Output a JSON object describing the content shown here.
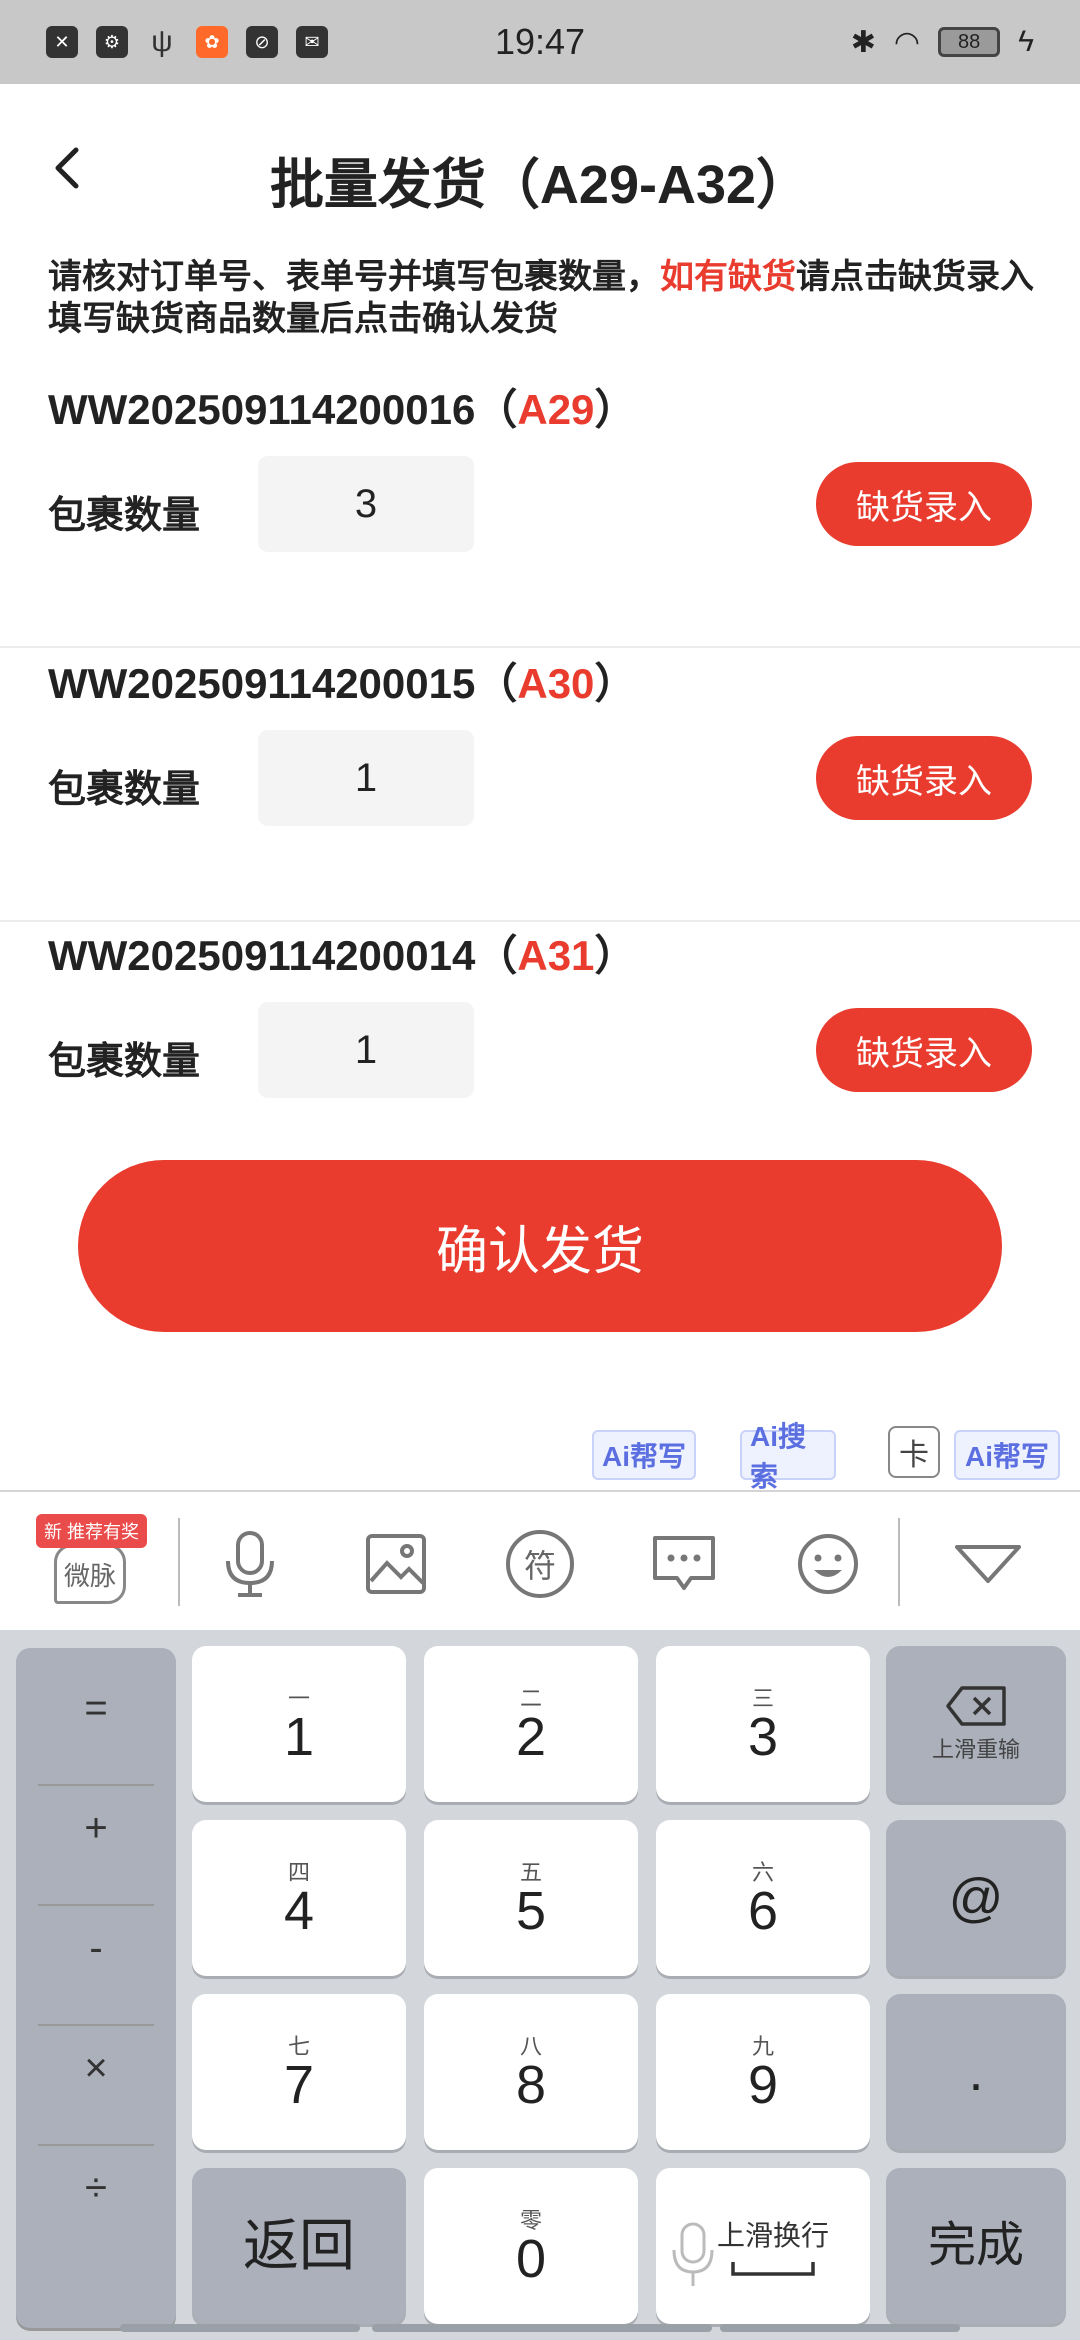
{
  "status_bar": {
    "time": "19:47",
    "battery": "88"
  },
  "header": {
    "title": "批量发货（A29-A32）"
  },
  "notice": {
    "part1": "请核对订单号、表单号并填写包裹数量，",
    "highlight": "如有缺货",
    "part2": "请点击缺货录入填写缺货商品数量后点击确认发货"
  },
  "orders": [
    {
      "id": "WW202509114200016",
      "code": "A29",
      "qty_label": "包裹数量",
      "qty": "3",
      "button": "缺货录入"
    },
    {
      "id": "WW202509114200015",
      "code": "A30",
      "qty_label": "包裹数量",
      "qty": "1",
      "button": "缺货录入"
    },
    {
      "id": "WW202509114200014",
      "code": "A31",
      "qty_label": "包裹数量",
      "qty": "1",
      "button": "缺货录入"
    }
  ],
  "paren_open": "（",
  "paren_close": "）",
  "confirm_button": "确认发货",
  "ai_bar": {
    "chip1": "Ai帮写",
    "chip2": "Ai搜索",
    "card": "卡",
    "chip3": "Ai帮写"
  },
  "toolbar": {
    "badge": "新 推荐有奖",
    "weimai": "微脉",
    "symbol": "符"
  },
  "keyboard": {
    "side": [
      "=",
      "+",
      "-",
      "×",
      "÷"
    ],
    "keys": [
      {
        "sub": "一",
        "main": "1"
      },
      {
        "sub": "二",
        "main": "2"
      },
      {
        "sub": "三",
        "main": "3"
      },
      {
        "sub": "四",
        "main": "4"
      },
      {
        "sub": "五",
        "main": "5"
      },
      {
        "sub": "六",
        "main": "6"
      },
      {
        "sub": "七",
        "main": "7"
      },
      {
        "sub": "八",
        "main": "8"
      },
      {
        "sub": "九",
        "main": "9"
      },
      {
        "sub": "零",
        "main": "0"
      }
    ],
    "delete_hint": "上滑重输",
    "at": "@",
    "dot": ".",
    "back": "返回",
    "space_hint": "上滑换行",
    "done": "完成"
  },
  "colors": {
    "accent": "#e93b2e"
  }
}
